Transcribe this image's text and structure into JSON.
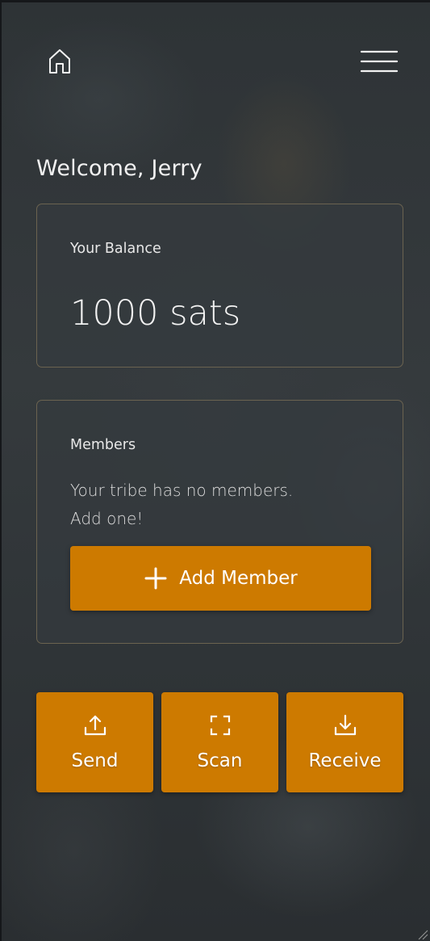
{
  "header": {
    "home_icon": "home-icon",
    "menu_icon": "hamburger-menu-icon"
  },
  "greeting": "Welcome, Jerry",
  "balance": {
    "label": "Your Balance",
    "value": "1000 sats"
  },
  "members": {
    "label": "Members",
    "empty_line1": "Your tribe has no members.",
    "empty_line2": "Add one!",
    "add_button": "Add Member",
    "add_icon": "plus-icon"
  },
  "actions": [
    {
      "label": "Send",
      "icon": "upload-icon"
    },
    {
      "label": "Scan",
      "icon": "scan-frame-icon"
    },
    {
      "label": "Receive",
      "icon": "download-icon"
    }
  ],
  "colors": {
    "accent": "#cd7a00",
    "card_border": "#6b6350",
    "text": "#f1f1f1"
  }
}
